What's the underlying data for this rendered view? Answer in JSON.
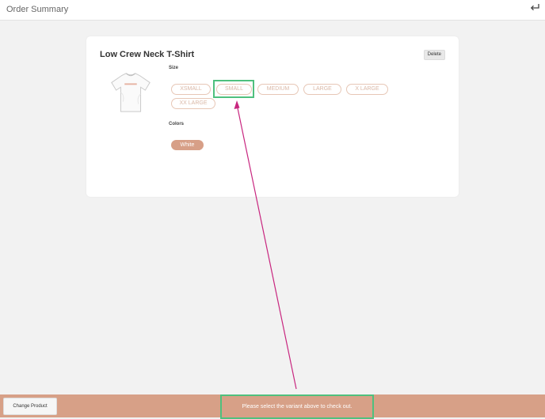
{
  "header": {
    "title": "Order Summary",
    "back_icon": "return-arrow-icon"
  },
  "product": {
    "name": "Low Crew Neck T-Shirt",
    "delete_label": "Delete",
    "image": "tshirt-image",
    "size_label": "Size",
    "sizes": [
      "XSMALL",
      "SMALL",
      "MEDIUM",
      "LARGE",
      "X LARGE",
      "XX LARGE"
    ],
    "colors_label": "Colors",
    "colors": [
      "White"
    ]
  },
  "footer": {
    "change_label": "Change Product",
    "message": "Please select the variant above to check out."
  },
  "colors": {
    "accent": "#d7a087",
    "chip_border": "#e7c7b6",
    "highlight": "#4fc07e",
    "annotation_arrow": "#c8267f"
  }
}
